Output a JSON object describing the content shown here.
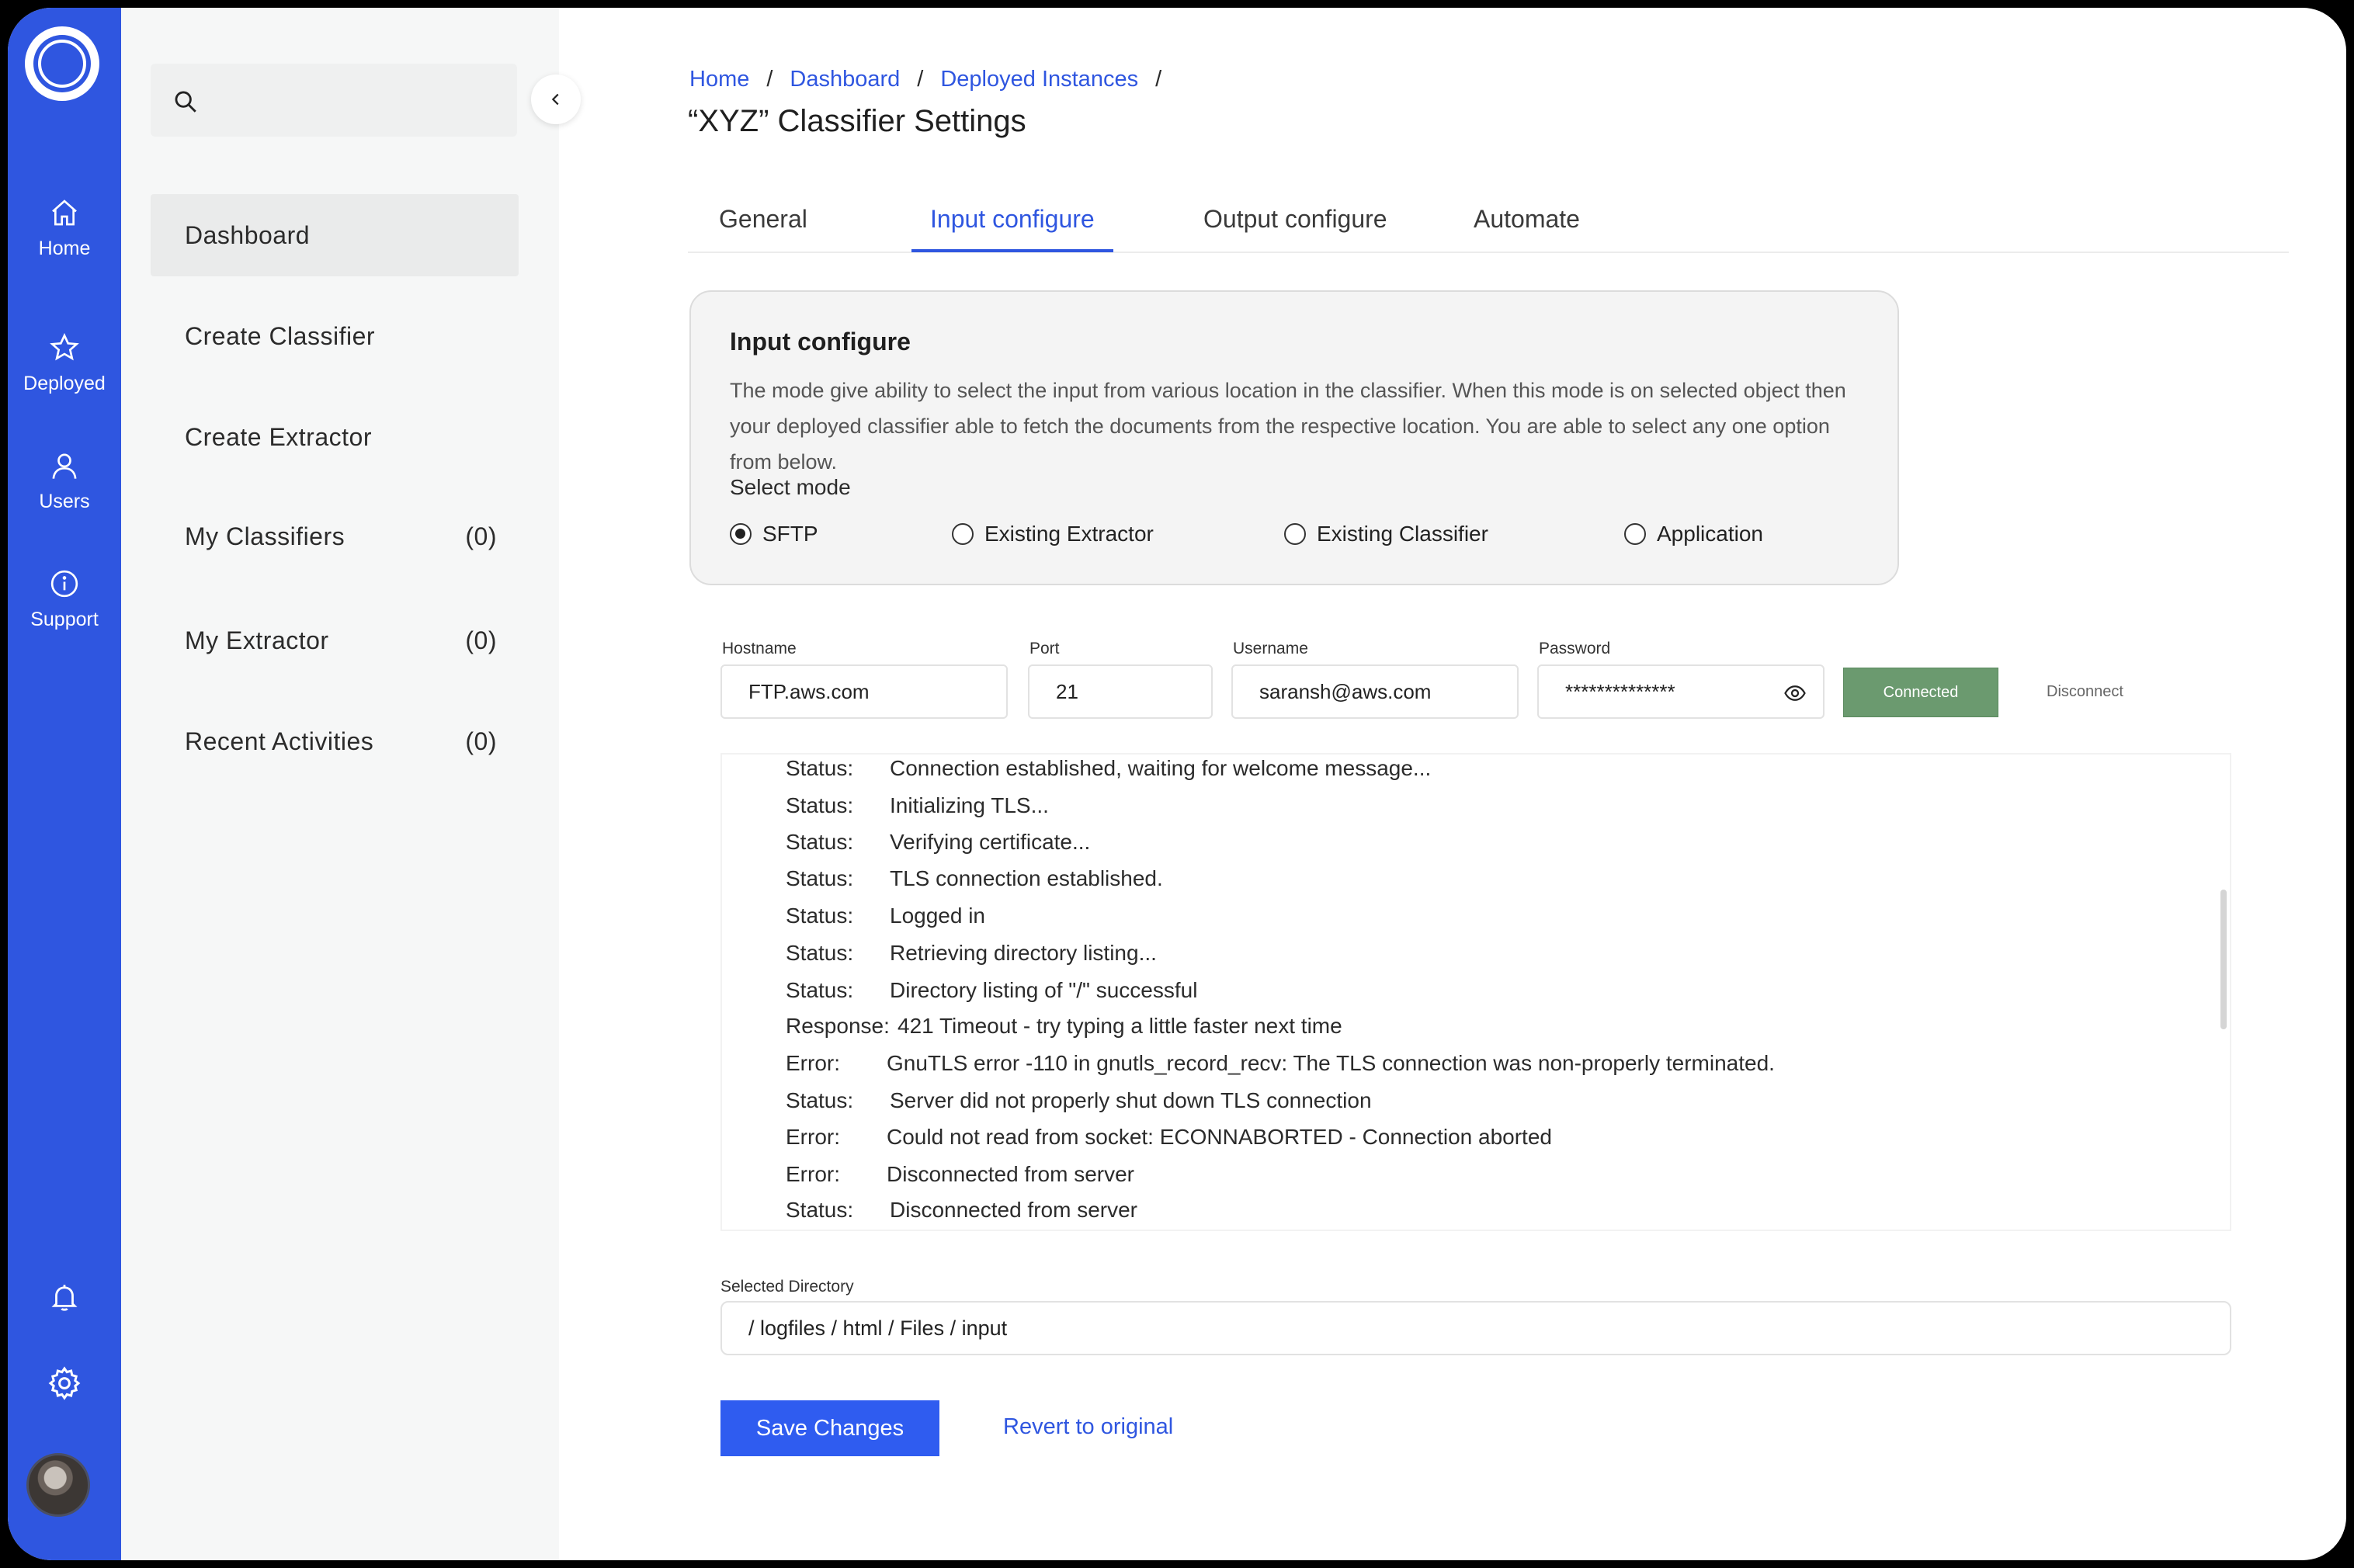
{
  "rail": {
    "items": [
      {
        "label": "Home",
        "icon": "home-icon"
      },
      {
        "label": "Deployed",
        "icon": "star-icon"
      },
      {
        "label": "Users",
        "icon": "user-icon"
      },
      {
        "label": "Support",
        "icon": "info-icon"
      }
    ],
    "bottom_icons": [
      "bell-icon",
      "gear-icon"
    ],
    "accent_color": "#2f56e0"
  },
  "sidebar": {
    "search_placeholder": "",
    "items": [
      {
        "label": "Dashboard",
        "count": ""
      },
      {
        "label": "Create Classifier",
        "count": ""
      },
      {
        "label": "Create Extractor",
        "count": ""
      },
      {
        "label": "My Classifiers",
        "count": "(0)"
      },
      {
        "label": "My Extractor",
        "count": "(0)"
      },
      {
        "label": "Recent Activities",
        "count": "(0)"
      }
    ]
  },
  "breadcrumb": [
    "Home",
    "Dashboard",
    "Deployed Instances"
  ],
  "page_title": "“XYZ” Classifier Settings",
  "tabs": [
    "General",
    "Input configure",
    "Output configure",
    "Automate"
  ],
  "active_tab": "Input configure",
  "input_configure": {
    "title": "Input configure",
    "description": "The mode give ability to select the input from various location in the classifier. When this mode is on selected object then your deployed classifier able to fetch the documents from the respective location. You are able to select any one option from below.",
    "mode_label": "Select mode",
    "modes": [
      "SFTP",
      "Existing Extractor",
      "Existing Classifier",
      "Application"
    ],
    "selected_mode": "SFTP"
  },
  "connection": {
    "hostname_label": "Hostname",
    "hostname": "FTP.aws.com",
    "port_label": "Port",
    "port": "21",
    "username_label": "Username",
    "username": "saransh@aws.com",
    "password_label": "Password",
    "password": "**************",
    "connected_label": "Connected",
    "disconnect_label": "Disconnect",
    "connected_color": "#6b9a6f"
  },
  "log": [
    {
      "key": "Status:",
      "msg": "Connection established, waiting for welcome message..."
    },
    {
      "key": "Status:",
      "msg": "Initializing TLS..."
    },
    {
      "key": "Status:",
      "msg": "Verifying certificate..."
    },
    {
      "key": "Status:",
      "msg": "TLS connection established."
    },
    {
      "key": "Status:",
      "msg": "Logged in"
    },
    {
      "key": "Status:",
      "msg": "Retrieving directory listing..."
    },
    {
      "key": "Status:",
      "msg": "Directory listing of \"/\" successful"
    },
    {
      "key": "Response:",
      "msg": "421 Timeout - try typing a little faster next time"
    },
    {
      "key": "Error:",
      "msg": "GnuTLS error -110 in gnutls_record_recv: The TLS connection was non-properly terminated."
    },
    {
      "key": "Status:",
      "msg": "Server did not properly shut down TLS connection"
    },
    {
      "key": "Error:",
      "msg": "Could not read from socket: ECONNABORTED - Connection aborted"
    },
    {
      "key": "Error:",
      "msg": "Disconnected from server"
    },
    {
      "key": "Status:",
      "msg": "Disconnected from server"
    }
  ],
  "directory": {
    "label": "Selected Directory",
    "value": "/ logfiles / html / Files / input"
  },
  "actions": {
    "save_label": "Save Changes",
    "revert_label": "Revert to original"
  }
}
